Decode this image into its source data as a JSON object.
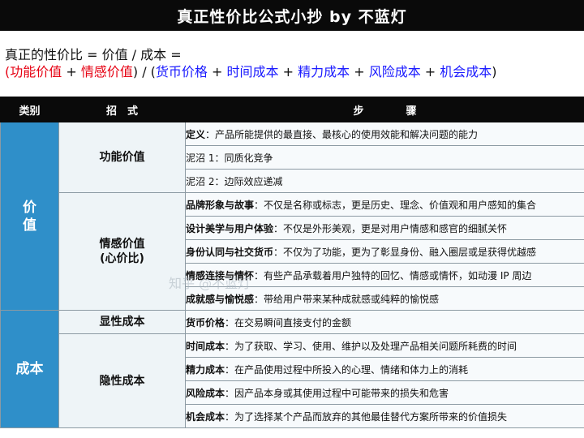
{
  "title": "真正性价比公式小抄 by 不蓝灯",
  "formula": {
    "line1": "真正的性价比 = 价值 / 成本 =",
    "paren_open": "(",
    "func_value": "功能价值",
    "plus1": " + ",
    "emo_value": "情感价值",
    "mid": ") / (",
    "cost1": "货币价格",
    "plus2": " + ",
    "cost2": "时间成本",
    "plus3": " + ",
    "cost3": "精力成本",
    "plus4": " + ",
    "cost4": "风险成本",
    "plus5": " + ",
    "cost5": "机会成本",
    "paren_close": ")"
  },
  "header": {
    "col1": "类别",
    "col2": "招　式",
    "col3": "步　　　　骤"
  },
  "categories": {
    "value": "价\n值",
    "cost": "成本"
  },
  "methods": {
    "func": "功能价值",
    "emo_line1": "情感价值",
    "emo_line2": "(心价比)",
    "explicit": "显性成本",
    "implicit": "隐性成本"
  },
  "steps": [
    {
      "label": "定义",
      "text": "：产品所能提供的最直接、最核心的使用效能和解决问题的能力"
    },
    {
      "label": "",
      "text": "泥沼 1：同质化竞争"
    },
    {
      "label": "",
      "text": "泥沼 2：边际效应递减"
    },
    {
      "label": "品牌形象与故事",
      "text": "：不仅是名称或标志，更是历史、理念、价值观和用户感知的集合"
    },
    {
      "label": "设计美学与用户体验",
      "text": "：不仅是外形美观，更是对用户情感和感官的细腻关怀"
    },
    {
      "label": "身份认同与社交货币",
      "text": "：不仅为了功能，更为了彰显身份、融入圈层或是获得优越感"
    },
    {
      "label": "情感连接与情怀",
      "text": "：有些产品承载着用户独特的回忆、情感或情怀，如动漫 IP 周边"
    },
    {
      "label": "成就感与愉悦感",
      "text": "：带给用户带来某种成就感或纯粹的愉悦感"
    },
    {
      "label": "货币价格",
      "text": "：在交易瞬间直接支付的金额"
    },
    {
      "label": "时间成本",
      "text": "：为了获取、学习、使用、维护以及处理产品相关问题所耗费的时间"
    },
    {
      "label": "精力成本",
      "text": "：在产品使用过程中所投入的心理、情绪和体力上的消耗"
    },
    {
      "label": "风险成本",
      "text": "：因产品本身或其使用过程中可能带来的损失和危害"
    },
    {
      "label": "机会成本",
      "text": "：为了选择某个产品而放弃的其他最佳替代方案所带来的价值损失"
    }
  ],
  "watermark": "知乎 @不蓝灯",
  "colors": {
    "category_bg": "#2f8fc9",
    "header_bg": "#0a0a0a",
    "red": "#e60012",
    "blue": "#1a1aff"
  }
}
